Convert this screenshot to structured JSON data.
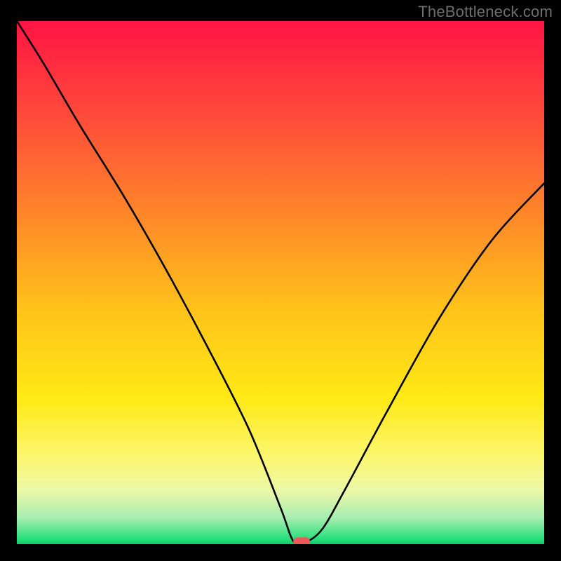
{
  "watermark": "TheBottleneck.com",
  "chart_data": {
    "type": "line",
    "title": "",
    "xlabel": "",
    "ylabel": "",
    "xlim": [
      0,
      100
    ],
    "ylim": [
      0,
      100
    ],
    "grid": false,
    "legend": null,
    "background_gradient": {
      "direction": "vertical",
      "stops": [
        {
          "pos": 0.0,
          "color": "#ff1444"
        },
        {
          "pos": 0.18,
          "color": "#ff4a3a"
        },
        {
          "pos": 0.38,
          "color": "#ff8a28"
        },
        {
          "pos": 0.55,
          "color": "#ffc21a"
        },
        {
          "pos": 0.72,
          "color": "#ffe914"
        },
        {
          "pos": 0.84,
          "color": "#fbf774"
        },
        {
          "pos": 0.9,
          "color": "#e9f7a8"
        },
        {
          "pos": 0.95,
          "color": "#a6edb0"
        },
        {
          "pos": 0.99,
          "color": "#28e07b"
        },
        {
          "pos": 1.0,
          "color": "#12c86a"
        }
      ]
    },
    "series": [
      {
        "name": "bottleneck-curve",
        "color": "#000000",
        "x": [
          0,
          5,
          12,
          20,
          28,
          36,
          44,
          50,
          52.5,
          55,
          58,
          62,
          70,
          80,
          90,
          100
        ],
        "values": [
          100,
          92,
          80,
          67,
          53,
          38,
          22,
          7,
          0.5,
          0.5,
          3,
          10,
          25,
          43,
          58,
          69
        ]
      }
    ],
    "marker": {
      "name": "optimal-point",
      "x": 54,
      "y": 0.5,
      "shape": "rounded-rect",
      "color": "#ee5a5a"
    }
  }
}
